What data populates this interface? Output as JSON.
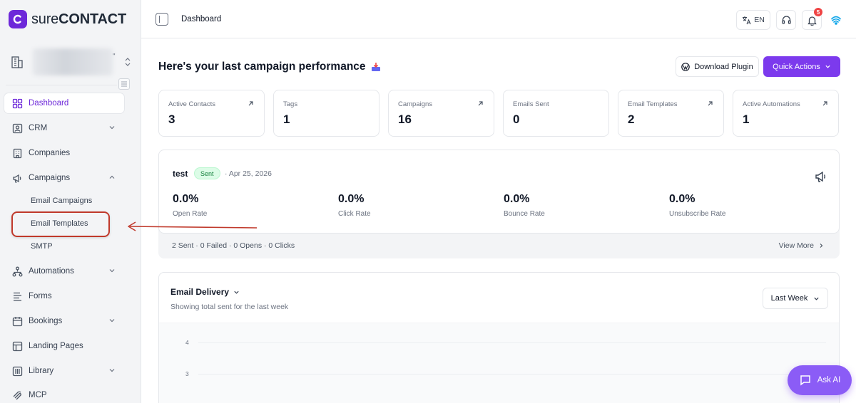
{
  "app": {
    "logo_prefix": "sure",
    "logo_suffix": "CONTACT"
  },
  "sidebar": {
    "items": [
      {
        "label": "Dashboard",
        "icon": "dashboard-icon",
        "active": true
      },
      {
        "label": "CRM",
        "icon": "crm-icon",
        "expandable": true
      },
      {
        "label": "Companies",
        "icon": "building-icon"
      },
      {
        "label": "Campaigns",
        "icon": "megaphone-icon",
        "expanded": true
      },
      {
        "label": "Automations",
        "icon": "automation-icon",
        "expandable": true
      },
      {
        "label": "Forms",
        "icon": "forms-icon"
      },
      {
        "label": "Bookings",
        "icon": "calendar-icon",
        "expandable": true
      },
      {
        "label": "Landing Pages",
        "icon": "layout-icon"
      },
      {
        "label": "Library",
        "icon": "library-icon",
        "expandable": true
      },
      {
        "label": "MCP",
        "icon": "mcp-icon"
      }
    ],
    "campaign_subitems": [
      "Email Campaigns",
      "Email Templates",
      "SMTP"
    ]
  },
  "topbar": {
    "breadcrumb": "Dashboard",
    "language": "EN",
    "notification_count": "5"
  },
  "header": {
    "title": "Here's your last campaign performance",
    "download_label": "Download Plugin",
    "quick_actions_label": "Quick Actions"
  },
  "stats": [
    {
      "label": "Active Contacts",
      "value": "3",
      "link": true
    },
    {
      "label": "Tags",
      "value": "1",
      "link": false
    },
    {
      "label": "Campaigns",
      "value": "16",
      "link": true
    },
    {
      "label": "Emails Sent",
      "value": "0",
      "link": false
    },
    {
      "label": "Email Templates",
      "value": "2",
      "link": true
    },
    {
      "label": "Active Automations",
      "value": "1",
      "link": true
    }
  ],
  "campaign": {
    "name": "test",
    "status": "Sent",
    "date": "· Apr 25, 2026",
    "metrics": [
      {
        "value": "0.0%",
        "label": "Open Rate"
      },
      {
        "value": "0.0%",
        "label": "Click Rate"
      },
      {
        "value": "0.0%",
        "label": "Bounce Rate"
      },
      {
        "value": "0.0%",
        "label": "Unsubscribe Rate"
      }
    ],
    "summary": "2 Sent · 0 Failed · 0 Opens · 0 Clicks",
    "view_more": "View More"
  },
  "delivery": {
    "title": "Email Delivery",
    "subtitle": "Showing total sent for the last week",
    "range": "Last Week",
    "y_ticks": [
      "4",
      "3"
    ]
  },
  "chat": {
    "label": "Ask AI"
  },
  "colors": {
    "accent": "#7c3aed",
    "annotation": "#c0392b"
  }
}
